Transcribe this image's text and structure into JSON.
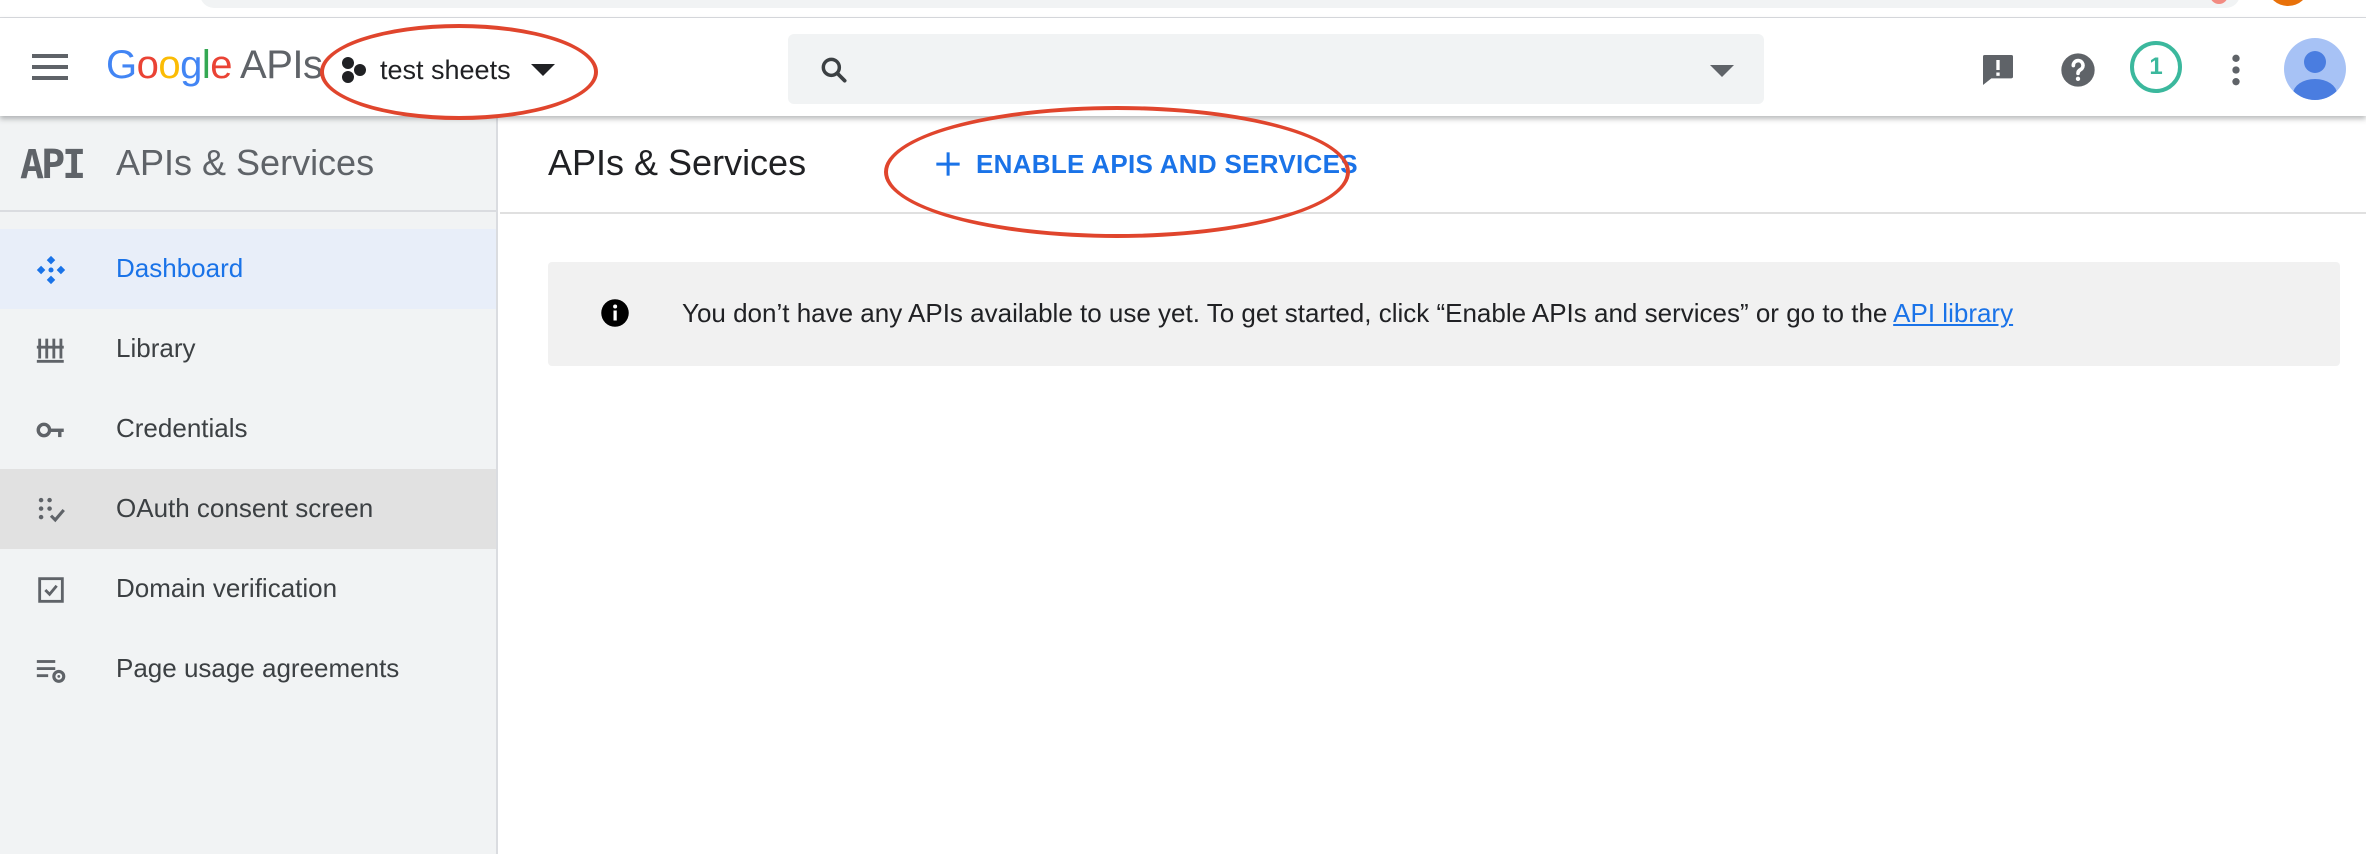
{
  "header": {
    "logo_google": "Google",
    "logo_apis": "APIs",
    "project_name": "test sheets",
    "search_placeholder": "",
    "notification_count": "1"
  },
  "sidebar": {
    "title": "APIs & Services",
    "items": [
      {
        "label": "Dashboard",
        "icon": "dashboard-icon",
        "state": "active"
      },
      {
        "label": "Library",
        "icon": "library-icon"
      },
      {
        "label": "Credentials",
        "icon": "key-icon"
      },
      {
        "label": "OAuth consent screen",
        "icon": "consent-icon",
        "state": "hover"
      },
      {
        "label": "Domain verification",
        "icon": "checkbox-icon"
      },
      {
        "label": "Page usage agreements",
        "icon": "settings-list-icon"
      }
    ]
  },
  "main": {
    "title": "APIs & Services",
    "enable_button": "ENABLE APIS AND SERVICES",
    "banner_text": "You don’t have any APIs available to use yet. To get started, click “Enable APIs and services” or go to the ",
    "banner_link": "API library"
  },
  "colors": {
    "accent": "#1a73e8",
    "annotation": "#e0452d",
    "sidebar_bg": "#f1f3f4",
    "active_bg": "#e8eef9",
    "notif_ring": "#3bb89d"
  }
}
